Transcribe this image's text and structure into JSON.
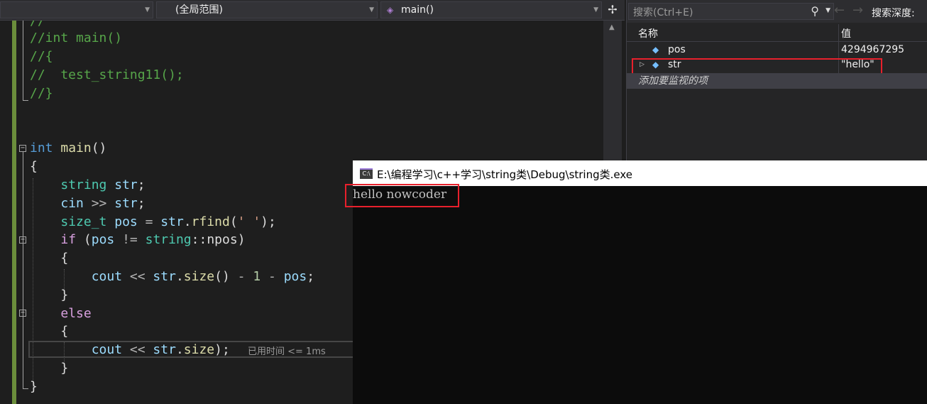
{
  "nav": {
    "project_combo": "",
    "scope_combo": "(全局范围)",
    "member_combo": "main()"
  },
  "code": {
    "c1": "//",
    "c2": "//int main()",
    "c3": "//{",
    "c4": "//  test_string11();",
    "c5": "//}",
    "l_int": "int",
    "l_main": "main",
    "l_parens": "()",
    "l_open": "{",
    "l_string": "string",
    "l_str": "str",
    "l_semi": ";",
    "l_cin": "cin",
    "l_shr": " >> ",
    "l_sizet": "size_t",
    "l_pos": "pos",
    "l_eq": " = ",
    "l_dot": ".",
    "l_rfind": "rfind",
    "l_lp": "(",
    "l_char": "' '",
    "l_rp": ");",
    "l_if": "if",
    "l_ne": " != ",
    "l_scope": "::",
    "l_npos": "npos",
    "l_cout": "cout",
    "l_shl": " << ",
    "l_size": "size",
    "l_minus": " - ",
    "l_one": "1",
    "l_close": "}",
    "l_else": "else",
    "perf_tip": "已用时间 <= 1ms"
  },
  "watch": {
    "search_placeholder": "搜索(Ctrl+E)",
    "depth_label": "搜索深度:",
    "col_name": "名称",
    "col_value": "值",
    "rows": [
      {
        "name": "pos",
        "value": "4294967295"
      },
      {
        "name": "str",
        "value": "\"hello\""
      }
    ],
    "add_item": "添加要监视的项"
  },
  "console": {
    "title": "E:\\编程学习\\c++学习\\string类\\Debug\\string类.exe",
    "icon_text": "C:\\",
    "output": "hello nowcoder"
  },
  "colors": {
    "comment": "#57a64a",
    "keyword": "#569cd6",
    "type": "#4ec9b0",
    "variable": "#9cdcfe",
    "function": "#dcdcaa",
    "highlight_box": "#e8202c"
  }
}
